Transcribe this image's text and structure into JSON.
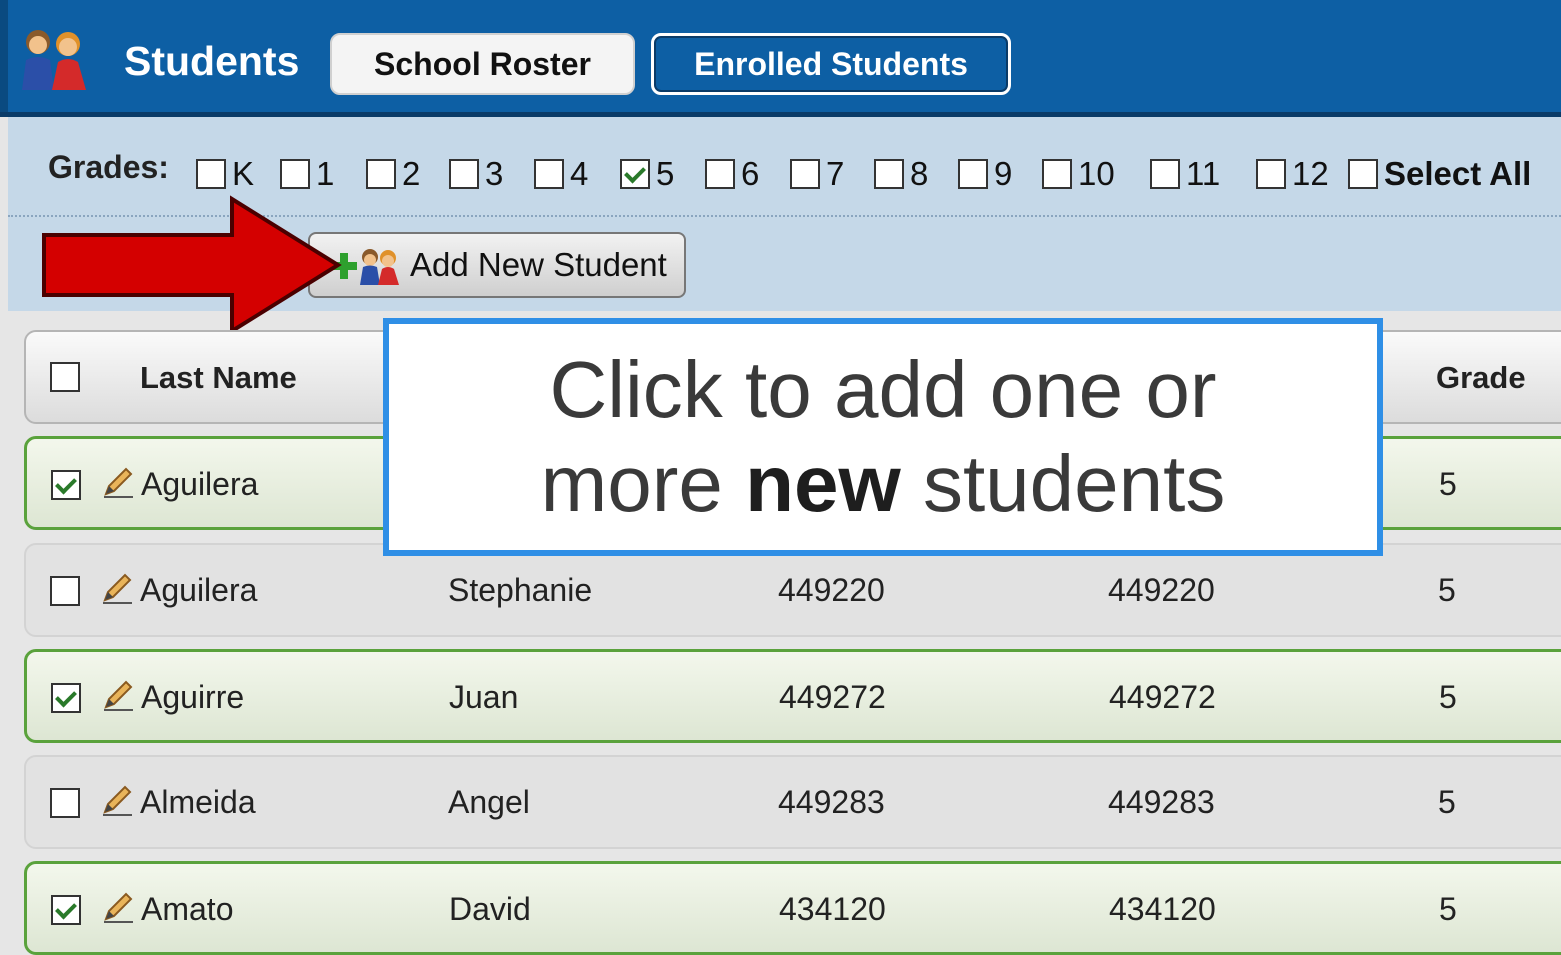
{
  "header": {
    "title": "Students",
    "tabs": [
      {
        "label": "School Roster",
        "active": true
      },
      {
        "label": "Enrolled Students",
        "active": false
      }
    ]
  },
  "filters": {
    "label": "Grades:",
    "grades": [
      {
        "label": "K",
        "checked": false
      },
      {
        "label": "1",
        "checked": false
      },
      {
        "label": "2",
        "checked": false
      },
      {
        "label": "3",
        "checked": false
      },
      {
        "label": "4",
        "checked": false
      },
      {
        "label": "5",
        "checked": true
      },
      {
        "label": "6",
        "checked": false
      },
      {
        "label": "7",
        "checked": false
      },
      {
        "label": "8",
        "checked": false
      },
      {
        "label": "9",
        "checked": false
      },
      {
        "label": "10",
        "checked": false
      },
      {
        "label": "11",
        "checked": false
      },
      {
        "label": "12",
        "checked": false
      }
    ],
    "select_all": "Select All"
  },
  "toolbar": {
    "add_student_label": "Add New Student"
  },
  "table": {
    "columns": {
      "last_name": "Last Name",
      "grade": "Grade"
    },
    "rows": [
      {
        "last": "Aguilera",
        "first": "",
        "id1": "",
        "id2": "",
        "grade": "5",
        "selected": true
      },
      {
        "last": "Aguilera",
        "first": "Stephanie",
        "id1": "449220",
        "id2": "449220",
        "grade": "5",
        "selected": false
      },
      {
        "last": "Aguirre",
        "first": "Juan",
        "id1": "449272",
        "id2": "449272",
        "grade": "5",
        "selected": true
      },
      {
        "last": "Almeida",
        "first": "Angel",
        "id1": "449283",
        "id2": "449283",
        "grade": "5",
        "selected": false
      },
      {
        "last": "Amato",
        "first": "David",
        "id1": "434120",
        "id2": "434120",
        "grade": "5",
        "selected": true
      }
    ]
  },
  "callout": {
    "line1": "Click to add one or",
    "line2_pre": "more ",
    "line2_bold": "new",
    "line2_post": " students"
  },
  "colors": {
    "header_bg": "#0d5fa4",
    "filter_bg": "#c5d8e8",
    "selected_border": "#5aa23c",
    "callout_border": "#2f8fe6",
    "arrow": "#d40000"
  },
  "icons": [
    "students-icon",
    "add-student-icon",
    "pencil-icon",
    "red-arrow"
  ]
}
